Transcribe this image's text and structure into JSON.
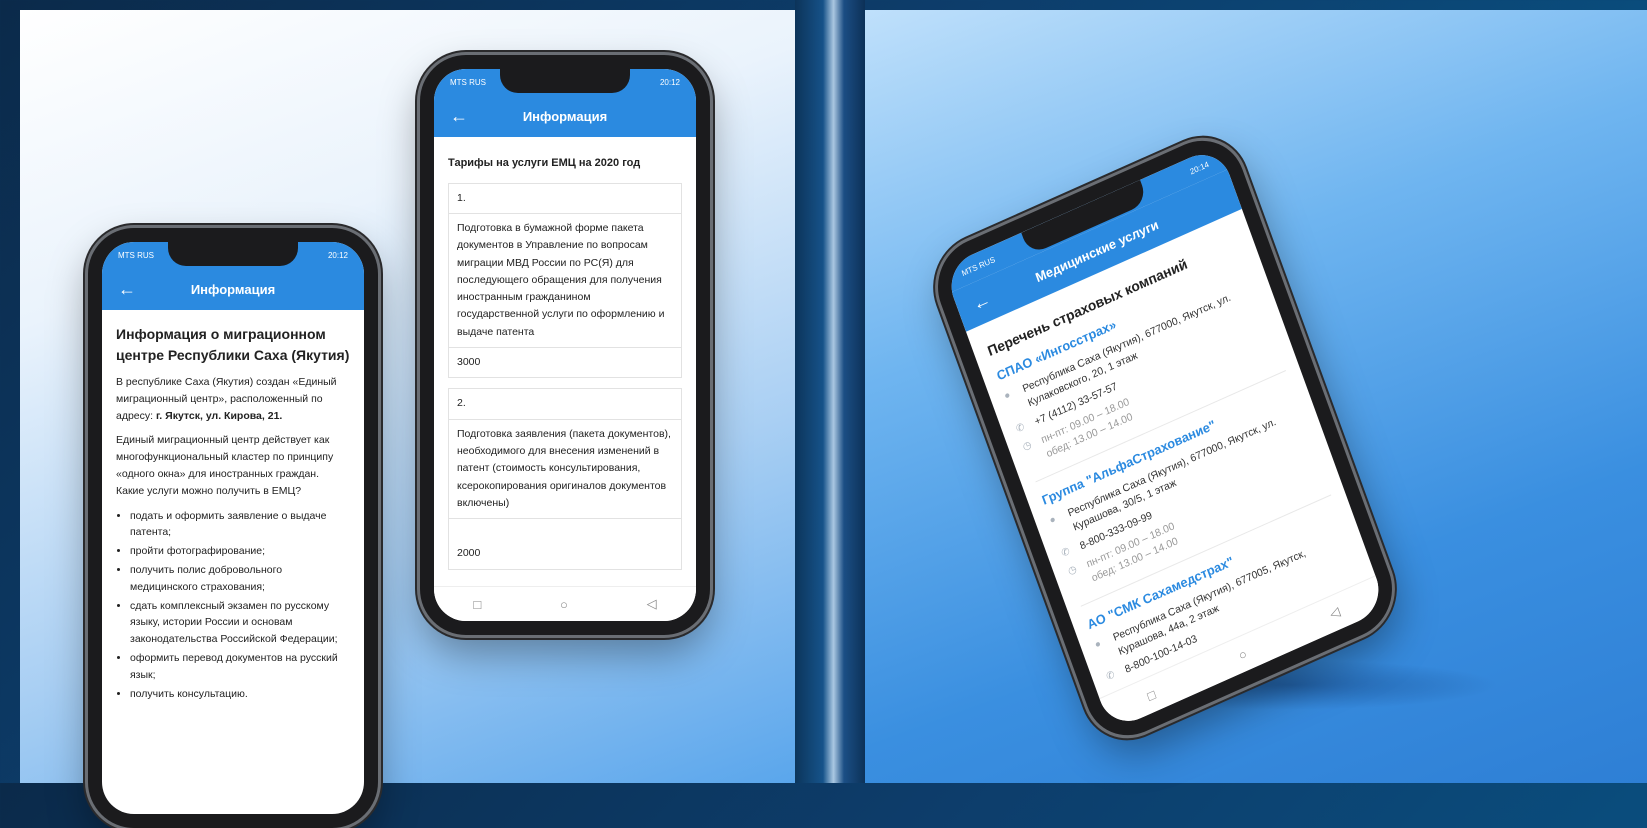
{
  "statusbar": {
    "operator": "MTS RUS",
    "time1": "20:12",
    "time2": "20:12",
    "time3": "20:14"
  },
  "phone1": {
    "appbar_title": "Информация",
    "heading": "Информация о миграционном центре Республики Саха (Якутия)",
    "para1_text": "В республике Саха (Якутия) создан «Единый миграционный центр», расположенный по адресу: ",
    "para1_address": "г. Якутск, ул. Кирова, 21.",
    "para2": "Единый миграционный центр действует как многофункциональный кластер по принципу «одного окна» для иностранных граждан. Какие услуги можно получить в ЕМЦ?",
    "services": [
      "подать и оформить заявление о выдаче патента;",
      "пройти фотографирование;",
      "получить полис добровольного медицинского страхования;",
      "сдать комплексный экзамен по русскому языку, истории России и основам законодательства Российской Федерации;",
      "оформить перевод документов на русский язык;",
      "получить консультацию."
    ]
  },
  "phone2": {
    "appbar_title": "Информация",
    "tariff_title": "Тарифы на услуги ЕМЦ на 2020  год",
    "items": [
      {
        "num": "1.",
        "desc": "Подготовка в бумажной форме пакета документов в Управление по вопросам миграции МВД России по РС(Я) для последующего обращения для получения иностранным гражданином государственной услуги по оформлению и выдаче патента",
        "price": "3000"
      },
      {
        "num": "2.",
        "desc": "Подготовка заявления (пакета документов), необходимого для внесения изменений в патент (стоимость консультирования, ксерокопирования оригиналов документов включены)",
        "price": "2000"
      }
    ],
    "nav": {
      "square": "□",
      "circle": "○",
      "back": "◁"
    }
  },
  "phone3": {
    "appbar_title": "Медицинские услуги",
    "list_title": "Перечень страховых компаний",
    "companies": [
      {
        "name": "СПАО «Ингосстрах»",
        "address": "Республика Саха (Якутия), 677000, Якутск, ул. Кулаковского, 20, 1 этаж",
        "phone": "+7 (4112) 33-57-57",
        "hours": "пн-пт: 09.00 – 18.00",
        "lunch": "обед: 13.00 – 14.00"
      },
      {
        "name": "Группа \"АльфаСтрахование\"",
        "address": "Республика Саха (Якутия), 677000, Якутск, ул. Курашова, 30/5, 1 этаж",
        "phone": "8-800-333-09-99",
        "hours": "пн-пт: 09.00 – 18.00",
        "lunch": "обед: 13.00 – 14.00"
      },
      {
        "name": "АО \"СМК Сахамедстрах\"",
        "address": "Республика Саха (Якутия), 677005, Якутск, Курашова, 44а, 2 этаж",
        "phone": "8-800-100-14-03"
      }
    ]
  }
}
